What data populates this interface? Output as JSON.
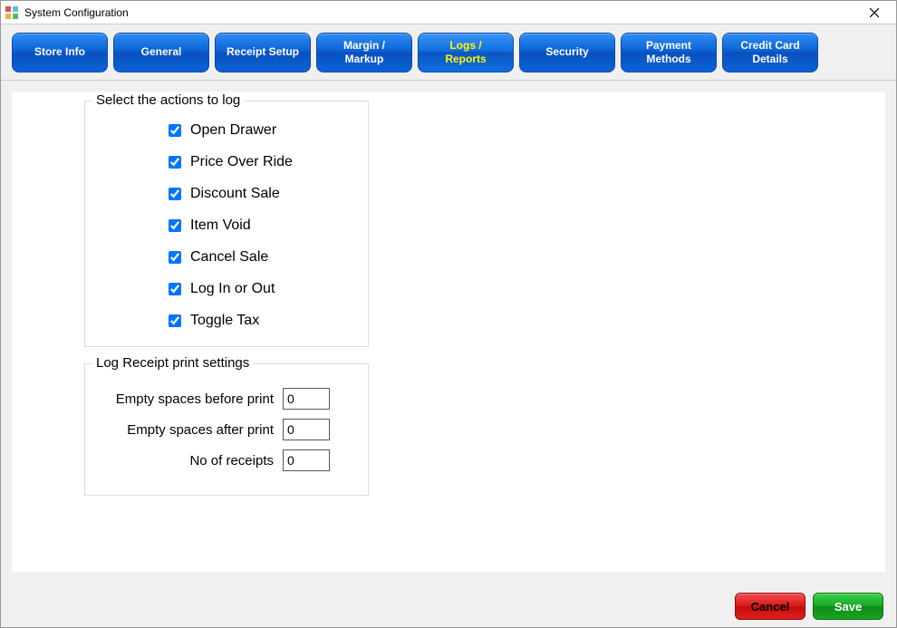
{
  "window": {
    "title": "System Configuration"
  },
  "tabs": [
    {
      "label": "Store Info"
    },
    {
      "label": "General"
    },
    {
      "label": "Receipt Setup"
    },
    {
      "label": "Margin /\nMarkup"
    },
    {
      "label": "Logs /\nReports",
      "active": true
    },
    {
      "label": "Security"
    },
    {
      "label": "Payment\nMethods"
    },
    {
      "label": "Credit Card\nDetails"
    }
  ],
  "actionsGroup": {
    "legend": "Select the actions to log",
    "items": [
      {
        "label": "Open Drawer",
        "checked": true
      },
      {
        "label": "Price Over Ride",
        "checked": true
      },
      {
        "label": "Discount Sale",
        "checked": true
      },
      {
        "label": "Item Void",
        "checked": true
      },
      {
        "label": "Cancel Sale",
        "checked": true
      },
      {
        "label": "Log In or Out",
        "checked": true
      },
      {
        "label": "Toggle Tax",
        "checked": true
      }
    ]
  },
  "printGroup": {
    "legend": "Log Receipt print settings",
    "rows": [
      {
        "label": "Empty spaces before print",
        "value": "0"
      },
      {
        "label": "Empty spaces after print",
        "value": "0"
      },
      {
        "label": "No of receipts",
        "value": "0"
      }
    ]
  },
  "footer": {
    "cancel": "Cancel",
    "save": "Save"
  }
}
